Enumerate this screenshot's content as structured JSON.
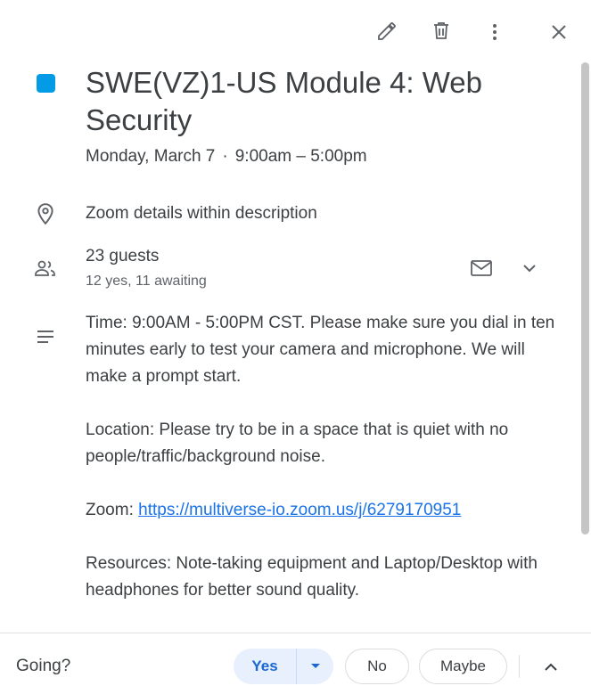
{
  "toolbar": {
    "edit_icon": "pencil-icon",
    "delete_icon": "trash-icon",
    "more_icon": "more-vert-icon",
    "close_icon": "close-icon"
  },
  "event": {
    "color": "#039be5",
    "title": "SWE(VZ)1-US Module 4: Web Security",
    "date": "Monday, March 7",
    "separator": "·",
    "time": "9:00am – 5:00pm"
  },
  "location": {
    "icon": "location-pin-icon",
    "text": "Zoom details within description"
  },
  "guests": {
    "icon": "people-icon",
    "title": "23 guests",
    "summary": "12 yes, 11 awaiting",
    "email_icon": "mail-icon",
    "expand_icon": "chevron-down-icon"
  },
  "description": {
    "icon": "notes-icon",
    "para1": "Time: 9:00AM - 5:00PM CST. Please make sure you dial in ten minutes early to test your camera and microphone. We will make a prompt start.",
    "para2": "Location: Please try to be in a space that is quiet with no people/traffic/background noise.",
    "zoom_label": "Zoom: ",
    "zoom_link": "https://multiverse-io.zoom.us/j/6279170951",
    "para4": "Resources: Note-taking equipment and Laptop/Desktop with headphones for better sound quality."
  },
  "footer": {
    "going_label": "Going?",
    "yes_label": "Yes",
    "no_label": "No",
    "maybe_label": "Maybe",
    "collapse_icon": "chevron-up-icon",
    "accent": "#1967d2"
  }
}
